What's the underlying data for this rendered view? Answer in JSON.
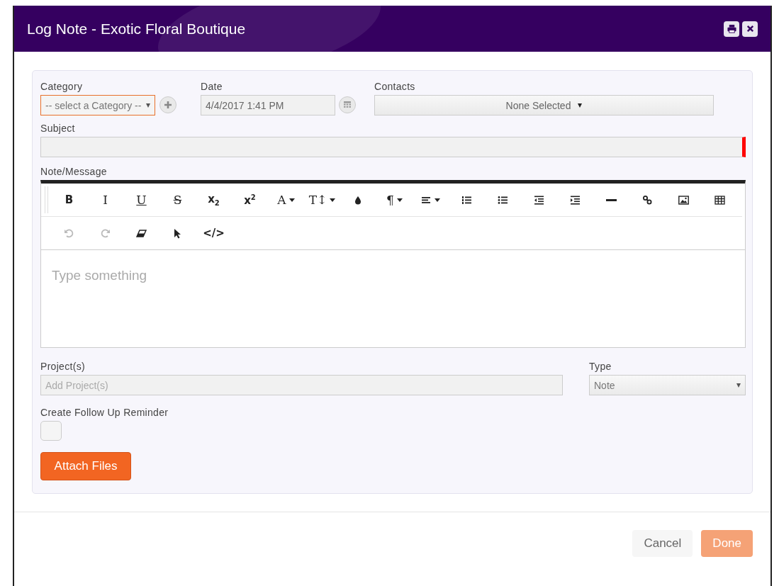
{
  "window": {
    "title": "Log Note - Exotic Floral Boutique"
  },
  "category": {
    "label": "Category",
    "placeholder": "-- select a Category --",
    "focused": true
  },
  "date": {
    "label": "Date",
    "value": "4/4/2017 1:41 PM"
  },
  "contacts": {
    "label": "Contacts",
    "value": "None Selected"
  },
  "subject": {
    "label": "Subject",
    "required": true
  },
  "note": {
    "label": "Note/Message",
    "placeholder": "Type something",
    "toolbar_rows": [
      [
        {
          "kind": "glyph",
          "label": "B",
          "dropdown": false,
          "disabled": false
        },
        {
          "kind": "glyph",
          "label": "I",
          "dropdown": false,
          "disabled": false
        },
        {
          "kind": "glyph",
          "label": "U",
          "dropdown": false,
          "disabled": false
        },
        {
          "kind": "glyph",
          "label": "S",
          "dropdown": false,
          "disabled": false
        },
        {
          "kind": "glyph",
          "label": "x$_{2}$",
          "dropdown": false,
          "disabled": false
        },
        {
          "kind": "glyph",
          "label": "x$^{2}$",
          "dropdown": false,
          "disabled": false
        },
        {
          "kind": "glyph",
          "label": "A",
          "dropdown": true,
          "disabled": false
        },
        {
          "kind": "glyph",
          "label": "T↕",
          "dropdown": true,
          "disabled": false
        },
        {
          "kind": "icon",
          "dropdown": false,
          "disabled": false
        },
        {
          "kind": "glyph",
          "label": "¶",
          "dropdown": true,
          "disabled": false
        },
        {
          "kind": "icon",
          "dropdown": true,
          "disabled": false
        },
        {
          "kind": "icon",
          "dropdown": false,
          "disabled": false
        },
        {
          "kind": "icon",
          "dropdown": false,
          "disabled": false
        },
        {
          "kind": "icon",
          "dropdown": false,
          "disabled": false
        },
        {
          "kind": "icon",
          "dropdown": false,
          "disabled": false
        },
        {
          "kind": "icon",
          "dropdown": false,
          "disabled": false
        },
        {
          "kind": "icon",
          "dropdown": false,
          "disabled": false
        },
        {
          "kind": "icon",
          "dropdown": false,
          "disabled": false
        },
        {
          "kind": "icon",
          "dropdown": false,
          "disabled": false
        }
      ],
      [
        {
          "kind": "icon",
          "dropdown": false,
          "disabled": true
        },
        {
          "kind": "icon",
          "dropdown": false,
          "disabled": true
        },
        {
          "kind": "icon",
          "dropdown": false,
          "disabled": false
        },
        {
          "kind": "icon",
          "dropdown": false,
          "disabled": false
        },
        {
          "kind": "glyph",
          "label": "</>",
          "dropdown": false,
          "disabled": false
        }
      ]
    ]
  },
  "projects": {
    "label": "Project(s)",
    "placeholder": "Add Project(s)"
  },
  "type": {
    "label": "Type",
    "value": "Note"
  },
  "reminder": {
    "label": "Create Follow Up Reminder",
    "checked": false
  },
  "attach_button": {
    "label": "Attach Files"
  },
  "footer_buttons": [
    {
      "label": "Cancel",
      "kind": "secondary",
      "disabled": false
    },
    {
      "label": "Done",
      "kind": "primary",
      "disabled": true
    }
  ]
}
